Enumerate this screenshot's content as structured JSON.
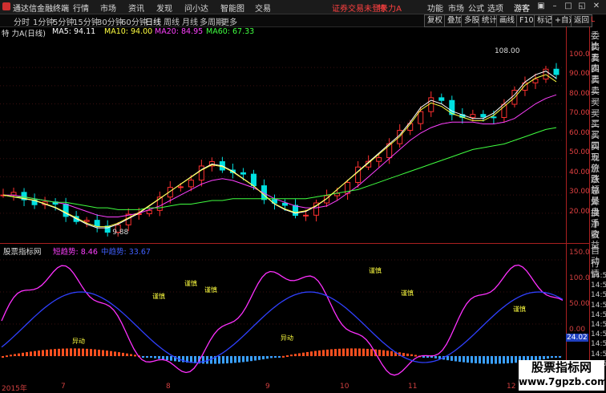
{
  "app": {
    "title": "通达信金融终端"
  },
  "menubar": {
    "items": [
      "行情",
      "市场",
      "资讯",
      "发现",
      "问小达",
      "智能图",
      "交易"
    ],
    "status": "证券交易未登录",
    "stock_name": "特 力A",
    "right_items": [
      "功能",
      "市场",
      "公式",
      "选项"
    ],
    "guest": "游客"
  },
  "periods": [
    "分时",
    "1分钟",
    "5分钟",
    "15分钟",
    "30分钟",
    "60分钟",
    "日线",
    "周线",
    "月线",
    "多周期",
    "更多"
  ],
  "active_period": "日线",
  "tools": [
    "复权",
    "叠加",
    "多股",
    "统计",
    "画线",
    "F10",
    "标记",
    "+自选",
    "返回"
  ],
  "ma": {
    "header": "特 力A(日线)",
    "items": [
      {
        "label": "MA5: 94.11",
        "color": "#ffffff"
      },
      {
        "label": "MA10: 94.00",
        "color": "#ffff40"
      },
      {
        "label": "MA20: 84.95",
        "color": "#ff40ff"
      },
      {
        "label": "MA60: 67.33",
        "color": "#40ff40"
      }
    ]
  },
  "price_axis": [
    "100.0",
    "90.00",
    "80.00",
    "70.00",
    "60.00",
    "50.00",
    "40.00",
    "30.00",
    "20.00"
  ],
  "indicator_axis": [
    "150.0",
    "100.0",
    "50.00",
    "0.00"
  ],
  "high_label": "108.00",
  "low_label": "9.88",
  "indicator": {
    "name": "股票指标网",
    "line1": "短趋势: 8.46",
    "line2": "中趋势: 33.67",
    "current": "24.02"
  },
  "side_panel": {
    "top_label": "L",
    "quote_labels": [
      "委比",
      "卖五",
      "卖四",
      "卖三",
      "卖二",
      "卖一",
      "买一",
      "买二",
      "买三",
      "买四",
      "买五",
      "现价",
      "涨跌",
      "涨幅",
      "总量",
      "外盘",
      "换手",
      "净资",
      "收益"
    ],
    "panel2_title": "自动",
    "panel2_sub": "行情",
    "times": [
      "14:50",
      "14:50",
      "14:50",
      "14:50",
      "14:50",
      "14:50",
      "14:50",
      "14:50",
      "14:50",
      "14:50"
    ]
  },
  "annotations": {
    "label_a": "谨慎",
    "label_b": "异动"
  },
  "xaxis": [
    "2015年",
    "7",
    "8",
    "9",
    "10",
    "11",
    "12"
  ],
  "watermark": {
    "line1": "股票指标网",
    "line2": "www.7gpzb.com"
  },
  "chart_data": {
    "type": "candlestick",
    "ylim": [
      5,
      115
    ],
    "indicator_ylim": [
      -40,
      160
    ],
    "series": [
      {
        "name": "MA5",
        "values": [
          30,
          29,
          28,
          27,
          25,
          23,
          20,
          17,
          14,
          12,
          12,
          14,
          17,
          20,
          24,
          28,
          32,
          36,
          40,
          44,
          47,
          46,
          43,
          39,
          35,
          30,
          25,
          22,
          20,
          21,
          24,
          28,
          33,
          38,
          43,
          48,
          53,
          58,
          63,
          70,
          78,
          82,
          80,
          76,
          74,
          72,
          72,
          75,
          80,
          85,
          92,
          96,
          98,
          94
        ]
      },
      {
        "name": "MA20",
        "values": [
          30,
          30,
          29,
          28,
          27,
          26,
          25,
          23,
          21,
          19,
          18,
          18,
          19,
          20,
          22,
          24,
          27,
          30,
          33,
          36,
          38,
          39,
          38,
          36,
          34,
          31,
          28,
          26,
          24,
          23,
          23,
          24,
          27,
          31,
          35,
          40,
          45,
          50,
          55,
          60,
          64,
          67,
          69,
          70,
          70,
          70,
          69,
          69,
          70,
          72,
          76,
          80,
          83,
          85
        ]
      },
      {
        "name": "MA60",
        "values": [
          30,
          29,
          29,
          28,
          27,
          26,
          26,
          25,
          24,
          23,
          23,
          22,
          22,
          22,
          23,
          23,
          24,
          25,
          25,
          26,
          27,
          27,
          28,
          28,
          28,
          28,
          28,
          28,
          28,
          28,
          29,
          30,
          31,
          32,
          33,
          35,
          37,
          39,
          41,
          43,
          45,
          47,
          49,
          51,
          53,
          55,
          56,
          57,
          58,
          60,
          62,
          64,
          66,
          67
        ]
      }
    ]
  }
}
